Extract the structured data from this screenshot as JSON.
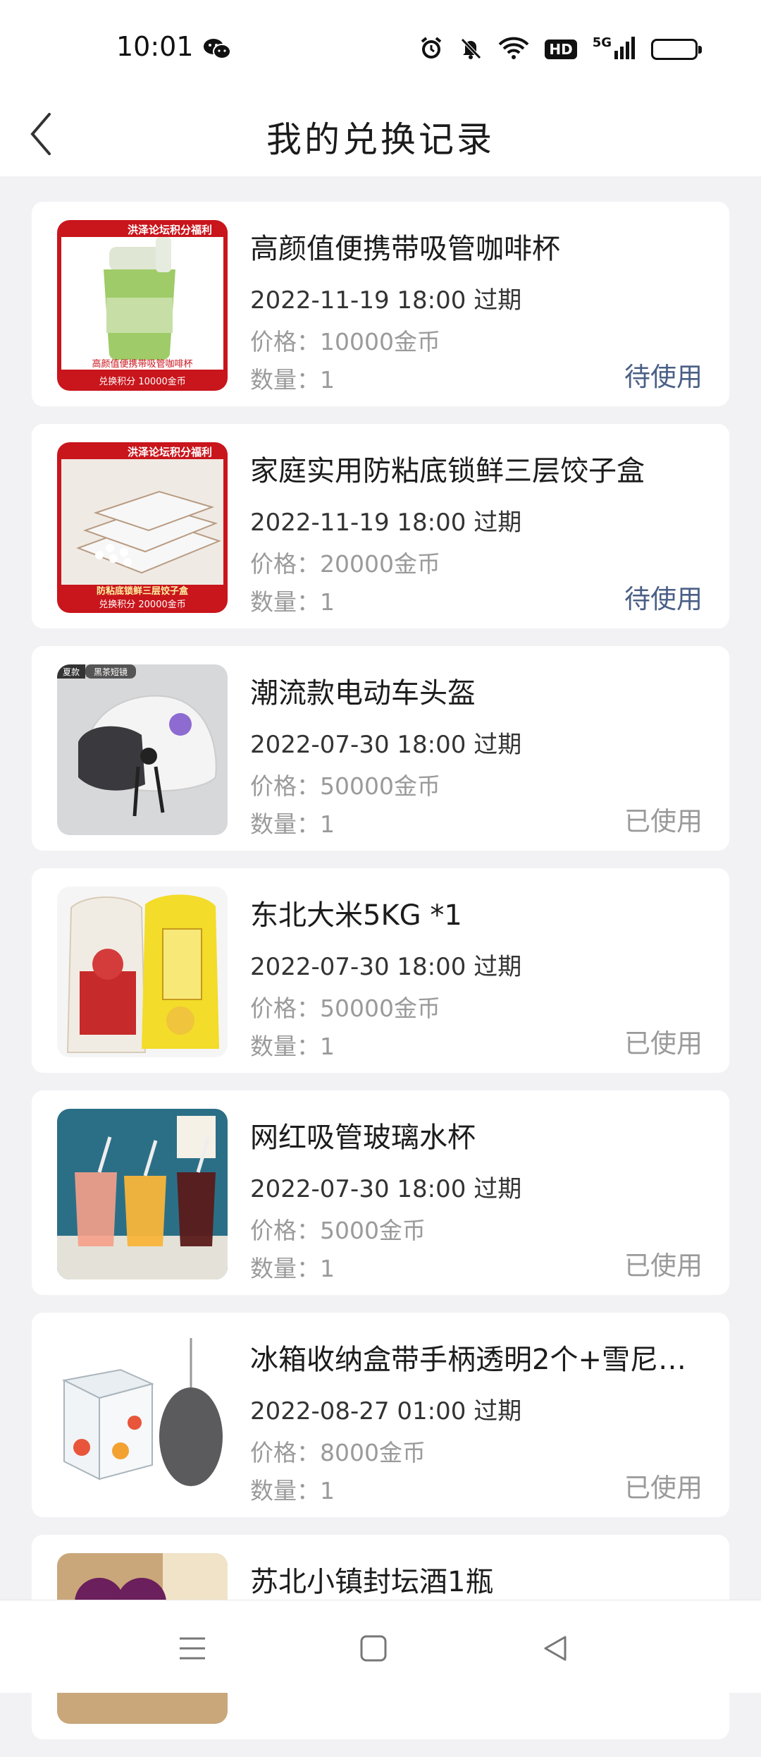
{
  "status_bar": {
    "time": "10:01",
    "hd_label": "HD",
    "network_label": "5G",
    "icons": [
      "wechat-icon",
      "alarm-icon",
      "mute-icon",
      "wifi-icon",
      "signal-icon",
      "battery-icon"
    ]
  },
  "header": {
    "title": "我的兑换记录",
    "back_icon": "chevron-left-icon"
  },
  "colors": {
    "pending": "#4a5f86",
    "used": "#9a9a9a",
    "background": "#f2f2f4"
  },
  "items": [
    {
      "title": "高颜值便携带吸管咖啡杯",
      "expire": "2022-11-19 18:00 过期",
      "price": "价格：10000金币",
      "qty": "数量：1",
      "status": "待使用",
      "thumb_banner": "洪泽论坛积分福利",
      "thumb_caption": "高颜值便携带吸管咖啡杯",
      "thumb_points": "兑换积分    10000金币"
    },
    {
      "title": "家庭实用防粘底锁鲜三层饺子盒",
      "expire": "2022-11-19 18:00 过期",
      "price": "价格：20000金币",
      "qty": "数量：1",
      "status": "待使用",
      "thumb_banner": "洪泽论坛积分福利",
      "thumb_caption": "防粘底锁鲜三层饺子盒",
      "thumb_points": "兑换积分    20000金币"
    },
    {
      "title": "潮流款电动车头盔",
      "expire": "2022-07-30 18:00 过期",
      "price": "价格：50000金币",
      "qty": "数量：1",
      "status": "已使用",
      "thumb_tag_1": "夏款",
      "thumb_tag_2": "黑茶短镜"
    },
    {
      "title": "东北大米5KG *1",
      "expire": "2022-07-30 18:00 过期",
      "price": "价格：50000金币",
      "qty": "数量：1",
      "status": "已使用"
    },
    {
      "title": "网红吸管玻璃水杯",
      "expire": "2022-07-30 18:00 过期",
      "price": "价格：5000金币",
      "qty": "数量：1",
      "status": "已使用"
    },
    {
      "title": "冰箱收纳盒带手柄透明2个+雪尼…",
      "expire": "2022-08-27 01:00 过期",
      "price": "价格：8000金币",
      "qty": "数量：1",
      "status": "已使用"
    },
    {
      "title": "苏北小镇封坛酒1瓶",
      "expire": "",
      "price": "",
      "qty": "",
      "status": ""
    }
  ],
  "bottom_nav": {
    "icons": [
      "menu-icon",
      "home-square-icon",
      "back-triangle-icon"
    ]
  }
}
